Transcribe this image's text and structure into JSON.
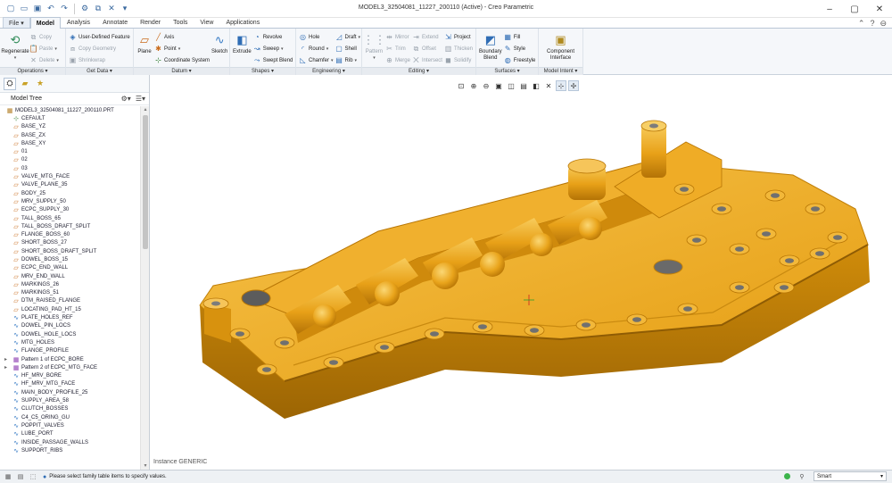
{
  "window": {
    "title": "MODEL3_32504081_11227_200110 (Active) - Creo Parametric",
    "colors": {
      "accent": "#2f6db5",
      "model_fill": "#e8a317",
      "model_shadow": "#a86e06",
      "model_highlight": "#f6c64e"
    }
  },
  "quick_access": [
    "new-icon",
    "open-icon",
    "save-icon",
    "undo-icon",
    "redo-icon",
    "regenerate-icon",
    "window-icon",
    "close-window-icon"
  ],
  "menu_tabs": [
    {
      "label": "File ▾",
      "active": false
    },
    {
      "label": "Model",
      "active": true
    },
    {
      "label": "Analysis",
      "active": false
    },
    {
      "label": "Annotate",
      "active": false
    },
    {
      "label": "Render",
      "active": false
    },
    {
      "label": "Tools",
      "active": false
    },
    {
      "label": "View",
      "active": false
    },
    {
      "label": "Applications",
      "active": false
    }
  ],
  "ribbon": {
    "operations": {
      "title": "Operations ▾",
      "regenerate": "Regenerate",
      "copy": "Copy",
      "paste": "Paste",
      "delete": "Delete"
    },
    "get_data": {
      "title": "Get Data ▾",
      "udf": "User-Defined Feature",
      "copy_geometry": "Copy Geometry",
      "shrinkwrap": "Shrinkwrap"
    },
    "datum": {
      "title": "Datum ▾",
      "plane": "Plane",
      "axis": "Axis",
      "point": "Point",
      "csys": "Coordinate System",
      "sketch": "Sketch"
    },
    "shapes": {
      "title": "Shapes ▾",
      "extrude": "Extrude",
      "revolve": "Revolve",
      "sweep": "Sweep",
      "swept_blend": "Swept Blend"
    },
    "engineering": {
      "title": "Engineering ▾",
      "hole": "Hole",
      "round": "Round",
      "chamfer": "Chamfer",
      "draft": "Draft",
      "shell": "Shell",
      "rib": "Rib"
    },
    "editing": {
      "title": "Editing ▾",
      "pattern": "Pattern",
      "mirror": "Mirror",
      "trim": "Trim",
      "merge": "Merge",
      "extend": "Extend",
      "offset": "Offset",
      "intersect": "Intersect",
      "project": "Project",
      "thicken": "Thicken",
      "solidify": "Solidify"
    },
    "surfaces": {
      "title": "Surfaces ▾",
      "boundary_blend": "Boundary Blend",
      "fill": "Fill",
      "style": "Style",
      "freestyle": "Freestyle"
    },
    "model_intent": {
      "title": "Model Intent ▾",
      "component_interface": "Component Interface"
    }
  },
  "panel": {
    "title": "Model Tree",
    "tree_root": "MODEL3_32504081_11227_200110.PRT",
    "items": [
      {
        "label": "CEFAULT",
        "icon": "csys",
        "expand": ""
      },
      {
        "label": "BASE_YZ",
        "icon": "plane",
        "expand": ""
      },
      {
        "label": "BASE_ZX",
        "icon": "plane",
        "expand": ""
      },
      {
        "label": "BASE_XY",
        "icon": "plane",
        "expand": ""
      },
      {
        "label": "01",
        "icon": "plane",
        "expand": ""
      },
      {
        "label": "02",
        "icon": "plane",
        "expand": ""
      },
      {
        "label": "03",
        "icon": "plane",
        "expand": ""
      },
      {
        "label": "VALVE_MTG_FACE",
        "icon": "plane",
        "expand": ""
      },
      {
        "label": "VALVE_PLANE_35",
        "icon": "plane",
        "expand": ""
      },
      {
        "label": "BODY_25",
        "icon": "plane",
        "expand": ""
      },
      {
        "label": "MRV_SUPPLY_50",
        "icon": "plane",
        "expand": ""
      },
      {
        "label": "ECPC_SUPPLY_30",
        "icon": "plane",
        "expand": ""
      },
      {
        "label": "TALL_BOSS_65",
        "icon": "plane",
        "expand": ""
      },
      {
        "label": "TALL_BOSS_DRAFT_SPLIT",
        "icon": "plane",
        "expand": ""
      },
      {
        "label": "FLANGE_BOSS_60",
        "icon": "plane",
        "expand": ""
      },
      {
        "label": "SHORT_BOSS_27",
        "icon": "plane",
        "expand": ""
      },
      {
        "label": "SHORT_BOSS_DRAFT_SPLIT",
        "icon": "plane",
        "expand": ""
      },
      {
        "label": "DOWEL_BOSS_15",
        "icon": "plane",
        "expand": ""
      },
      {
        "label": "ECPC_END_WALL",
        "icon": "plane",
        "expand": ""
      },
      {
        "label": "MRV_END_WALL",
        "icon": "plane",
        "expand": ""
      },
      {
        "label": "MARKINGS_26",
        "icon": "plane",
        "expand": ""
      },
      {
        "label": "MARKINGS_51",
        "icon": "plane",
        "expand": ""
      },
      {
        "label": "DTM_RAISED_FLANGE",
        "icon": "plane",
        "expand": ""
      },
      {
        "label": "LOCATING_PAD_HT_15",
        "icon": "plane",
        "expand": ""
      },
      {
        "label": "PLATE_HOLES_REF",
        "icon": "sketch",
        "expand": ""
      },
      {
        "label": "DOWEL_PIN_LOCS",
        "icon": "sketch",
        "expand": ""
      },
      {
        "label": "DOWEL_HOLE_LOCS",
        "icon": "sketch",
        "expand": ""
      },
      {
        "label": "MTG_HOLES",
        "icon": "sketch",
        "expand": ""
      },
      {
        "label": "FLANGE_PROFILE",
        "icon": "sketch",
        "expand": ""
      },
      {
        "label": "Pattern 1 of ECPC_BORE",
        "icon": "pattern",
        "expand": "▸"
      },
      {
        "label": "Pattern 2 of ECPC_MTG_FACE",
        "icon": "pattern",
        "expand": "▸"
      },
      {
        "label": "HF_MRV_BORE",
        "icon": "sketch",
        "expand": ""
      },
      {
        "label": "HF_MRV_MTG_FACE",
        "icon": "sketch",
        "expand": ""
      },
      {
        "label": "MAIN_BODY_PROFILE_25",
        "icon": "sketch",
        "expand": ""
      },
      {
        "label": "SUPPLY_AREA_58",
        "icon": "sketch",
        "expand": ""
      },
      {
        "label": "CLUTCH_BOSSES",
        "icon": "sketch",
        "expand": ""
      },
      {
        "label": "C4_C5_ORING_GU",
        "icon": "sketch",
        "expand": ""
      },
      {
        "label": "POPPIT_VALVES",
        "icon": "sketch",
        "expand": ""
      },
      {
        "label": "LUBE_PORT",
        "icon": "sketch",
        "expand": ""
      },
      {
        "label": "INSIDE_PASSAGE_WALLS",
        "icon": "sketch",
        "expand": ""
      },
      {
        "label": "SUPPORT_RIBS",
        "icon": "sketch",
        "expand": ""
      }
    ]
  },
  "graphics": {
    "instance_label": "Instance GENERIC",
    "toolbar": [
      "refit-icon",
      "zoom-in-icon",
      "zoom-out-icon",
      "repaint-icon",
      "view-manager-icon",
      "saved-views-icon",
      "display-style-icon",
      "datum-display-icon",
      "annotation-display-icon",
      "spin-center-icon"
    ]
  },
  "statusbar": {
    "message": "Please select family table items to specify values.",
    "filter": "Smart"
  }
}
